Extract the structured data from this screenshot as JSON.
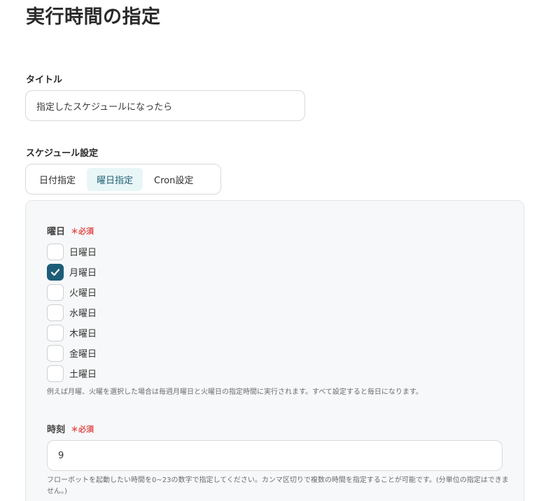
{
  "page": {
    "title": "実行時間の指定"
  },
  "title_field": {
    "label": "タイトル",
    "value": "指定したスケジュールになったら"
  },
  "schedule": {
    "label": "スケジュール設定",
    "tabs": [
      {
        "label": "日付指定",
        "active": false
      },
      {
        "label": "曜日指定",
        "active": true
      },
      {
        "label": "Cron設定",
        "active": false
      }
    ]
  },
  "weekday": {
    "label": "曜日",
    "required": "＊必須",
    "days": [
      {
        "label": "日曜日",
        "checked": false
      },
      {
        "label": "月曜日",
        "checked": true
      },
      {
        "label": "火曜日",
        "checked": false
      },
      {
        "label": "水曜日",
        "checked": false
      },
      {
        "label": "木曜日",
        "checked": false
      },
      {
        "label": "金曜日",
        "checked": false
      },
      {
        "label": "土曜日",
        "checked": false
      }
    ],
    "hint": "例えば月曜、火曜を選択した場合は毎週月曜日と火曜日の指定時間に実行されます。すべて設定すると毎日になります。"
  },
  "time": {
    "label": "時刻",
    "required": "＊必須",
    "value": "9",
    "hint": "フローボットを起動したい時間を0~23の数字で指定してください。カンマ区切りで複数の時間を指定することが可能です。(分単位の指定はできません。)"
  },
  "colors": {
    "accent": "#1d5d78",
    "required": "#e0504f",
    "tab_active_bg": "#e9f6f8"
  },
  "icons": {
    "checkmark": "check-icon"
  }
}
